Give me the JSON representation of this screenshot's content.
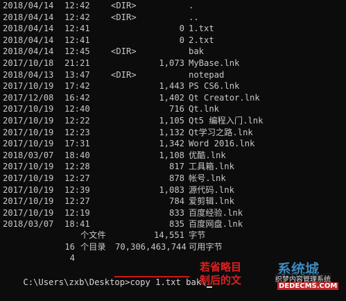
{
  "listing": [
    {
      "date": "2018/04/14",
      "time": "12:42",
      "dir": "<DIR>",
      "size": "",
      "name": "."
    },
    {
      "date": "2018/04/14",
      "time": "12:42",
      "dir": "<DIR>",
      "size": "",
      "name": ".."
    },
    {
      "date": "2018/04/14",
      "time": "12:41",
      "dir": "",
      "size": "0",
      "name": "1.txt"
    },
    {
      "date": "2018/04/14",
      "time": "12:41",
      "dir": "",
      "size": "0",
      "name": "2.txt"
    },
    {
      "date": "2018/04/14",
      "time": "12:45",
      "dir": "<DIR>",
      "size": "",
      "name": "bak"
    },
    {
      "date": "2017/10/18",
      "time": "21:21",
      "dir": "",
      "size": "1,073",
      "name": "MyBase.lnk"
    },
    {
      "date": "2018/04/13",
      "time": "13:47",
      "dir": "<DIR>",
      "size": "",
      "name": "notepad"
    },
    {
      "date": "2017/10/19",
      "time": "17:42",
      "dir": "",
      "size": "1,443",
      "name": "PS CS6.lnk"
    },
    {
      "date": "2017/12/08",
      "time": "16:42",
      "dir": "",
      "size": "1,402",
      "name": "Qt Creator.lnk"
    },
    {
      "date": "2017/10/19",
      "time": "12:40",
      "dir": "",
      "size": "716",
      "name": "Qt.lnk"
    },
    {
      "date": "2017/10/19",
      "time": "12:22",
      "dir": "",
      "size": "1,105",
      "name": "Qt5 编程入门.lnk"
    },
    {
      "date": "2017/10/19",
      "time": "12:23",
      "dir": "",
      "size": "1,132",
      "name": "Qt学习之路.lnk"
    },
    {
      "date": "2017/10/19",
      "time": "17:31",
      "dir": "",
      "size": "1,342",
      "name": "Word 2016.lnk"
    },
    {
      "date": "2018/03/07",
      "time": "18:40",
      "dir": "",
      "size": "1,108",
      "name": "优酷.lnk"
    },
    {
      "date": "2017/10/19",
      "time": "12:28",
      "dir": "",
      "size": "817",
      "name": "工具箱.lnk"
    },
    {
      "date": "2017/10/19",
      "time": "12:27",
      "dir": "",
      "size": "878",
      "name": "帐号.lnk"
    },
    {
      "date": "2017/10/19",
      "time": "12:39",
      "dir": "",
      "size": "1,083",
      "name": "源代码.lnk"
    },
    {
      "date": "2017/10/19",
      "time": "12:27",
      "dir": "",
      "size": "784",
      "name": "爱剪辑.lnk"
    },
    {
      "date": "2017/10/19",
      "time": "12:19",
      "dir": "",
      "size": "833",
      "name": "百度经验.lnk"
    },
    {
      "date": "2018/03/07",
      "time": "18:41",
      "dir": "",
      "size": "835",
      "name": "百度网盘.lnk"
    }
  ],
  "summary": {
    "files_count": "16",
    "files_label": "个文件",
    "files_bytes": "14,551",
    "files_unit": "字节",
    "dirs_count": "4",
    "dirs_label": "个目录",
    "dirs_free": "70,306,463,744",
    "dirs_unit": "可用字节"
  },
  "prompt": {
    "path": "C:\\Users\\zxb\\Desktop>",
    "command": "copy 1.txt bak\\"
  },
  "annotation": {
    "line1": "若省略目",
    "line2": "制后的文"
  },
  "watermark": {
    "logo": "系统城",
    "text": "织梦内容管理系统",
    "site": "DEDECMS.COM"
  },
  "colors": {
    "background": "#0c0c0c",
    "text": "#c8c8c8",
    "annotation": "#e02020"
  }
}
